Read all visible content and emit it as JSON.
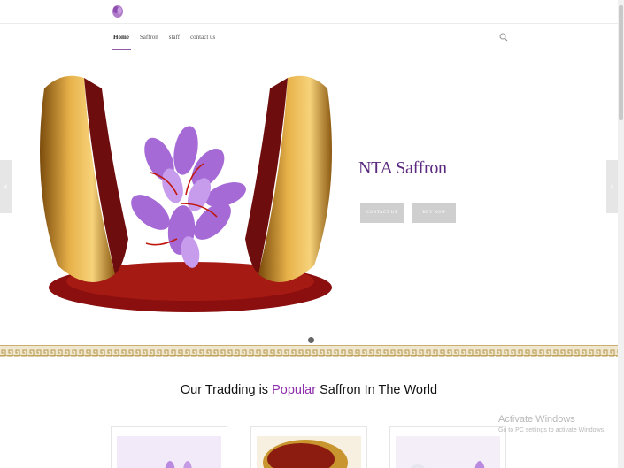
{
  "nav": {
    "items": [
      {
        "label": "Home",
        "active": true
      },
      {
        "label": "Saffron",
        "active": false
      },
      {
        "label": "staff",
        "active": false
      },
      {
        "label": "contact us",
        "active": false
      }
    ],
    "search_icon": "search-icon"
  },
  "hero": {
    "title": "NTA Saffron",
    "contact_label": "CONTACT US",
    "buy_label": "BUY NOW",
    "prev_arrow": "‹",
    "next_arrow": "›"
  },
  "section": {
    "heading_pre": "Our Tradding is ",
    "heading_highlight": "Popular",
    "heading_post": " Saffron In The World"
  },
  "watermark": {
    "line1": "Activate Windows",
    "line2": "Go to PC settings to activate Windows."
  },
  "colors": {
    "brand": "#5b2a7e",
    "highlight": "#8e2cab",
    "button": "#cfcfcf"
  }
}
